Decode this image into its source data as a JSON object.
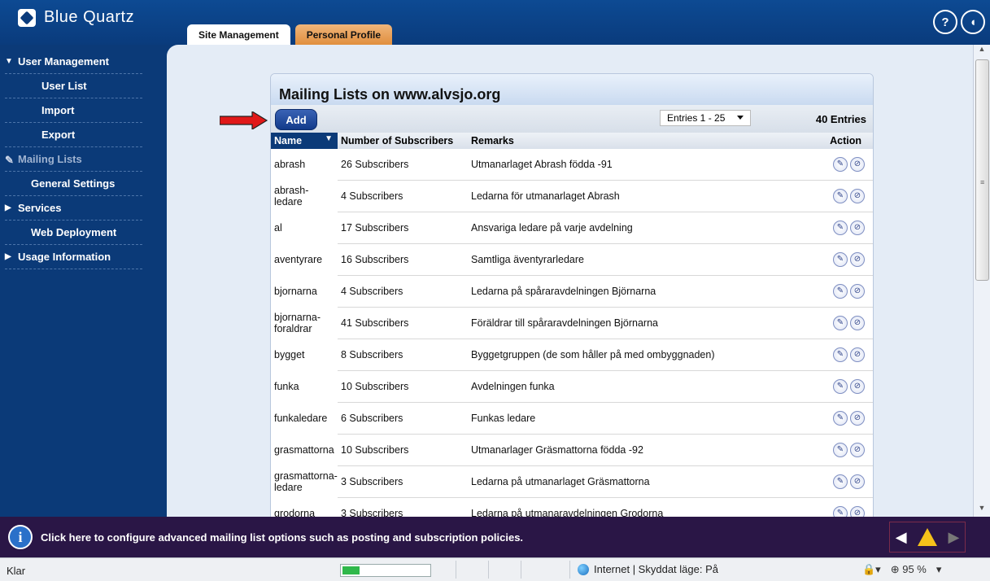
{
  "app": {
    "name": "Blue Quartz"
  },
  "tabs": [
    {
      "label": "Site Management"
    },
    {
      "label": "Personal Profile"
    }
  ],
  "top_icons": {
    "help": "?",
    "logout": "◖"
  },
  "sidebar": {
    "items": [
      {
        "label": "User Management"
      },
      {
        "label": "User List"
      },
      {
        "label": "Import"
      },
      {
        "label": "Export"
      },
      {
        "label": "Mailing Lists"
      },
      {
        "label": "General Settings"
      },
      {
        "label": "Services"
      },
      {
        "label": "Web Deployment"
      },
      {
        "label": "Usage Information"
      }
    ]
  },
  "panel": {
    "title": "Mailing Lists on www.alvsjo.org",
    "add_label": "Add",
    "entries_range": "Entries 1 - 25",
    "entries_total": "40 Entries",
    "columns": {
      "name": "Name",
      "subscribers": "Number of Subscribers",
      "remarks": "Remarks",
      "action": "Action"
    },
    "rows": [
      {
        "name": "abrash",
        "subscribers": "26 Subscribers",
        "remarks": "Utmanarlaget Abrash födda -91"
      },
      {
        "name": "abrash-ledare",
        "subscribers": "4 Subscribers",
        "remarks": "Ledarna för utmanarlaget Abrash"
      },
      {
        "name": "al",
        "subscribers": "17 Subscribers",
        "remarks": "Ansvariga ledare på varje avdelning"
      },
      {
        "name": "aventyrare",
        "subscribers": "16 Subscribers",
        "remarks": "Samtliga äventyrarledare"
      },
      {
        "name": "bjornarna",
        "subscribers": "4 Subscribers",
        "remarks": "Ledarna på spåraravdelningen Björnarna"
      },
      {
        "name": "bjornarna-foraldrar",
        "subscribers": "41 Subscribers",
        "remarks": "Föräldrar till spåraravdelningen Björnarna"
      },
      {
        "name": "bygget",
        "subscribers": "8 Subscribers",
        "remarks": "Byggetgruppen (de som håller på med ombyggnaden)"
      },
      {
        "name": "funka",
        "subscribers": "10 Subscribers",
        "remarks": "Avdelningen funka"
      },
      {
        "name": "funkaledare",
        "subscribers": "6 Subscribers",
        "remarks": "Funkas ledare"
      },
      {
        "name": "grasmattorna",
        "subscribers": "10 Subscribers",
        "remarks": "Utmanarlager Gräsmattorna födda -92"
      },
      {
        "name": "grasmattorna-ledare",
        "subscribers": "3 Subscribers",
        "remarks": "Ledarna på utmanarlaget Gräsmattorna"
      },
      {
        "name": "grodorna",
        "subscribers": "3 Subscribers",
        "remarks": "Ledarna på utmanaravdelningen Grodorna"
      }
    ]
  },
  "info_bar": {
    "icon": "i",
    "text": "Click here to configure advanced mailing list options such as posting and subscription policies."
  },
  "status_bar": {
    "left": "Klar",
    "progress_percent": 20,
    "zone": "Internet | Skyddat läge: På",
    "zoom": "95 %"
  }
}
